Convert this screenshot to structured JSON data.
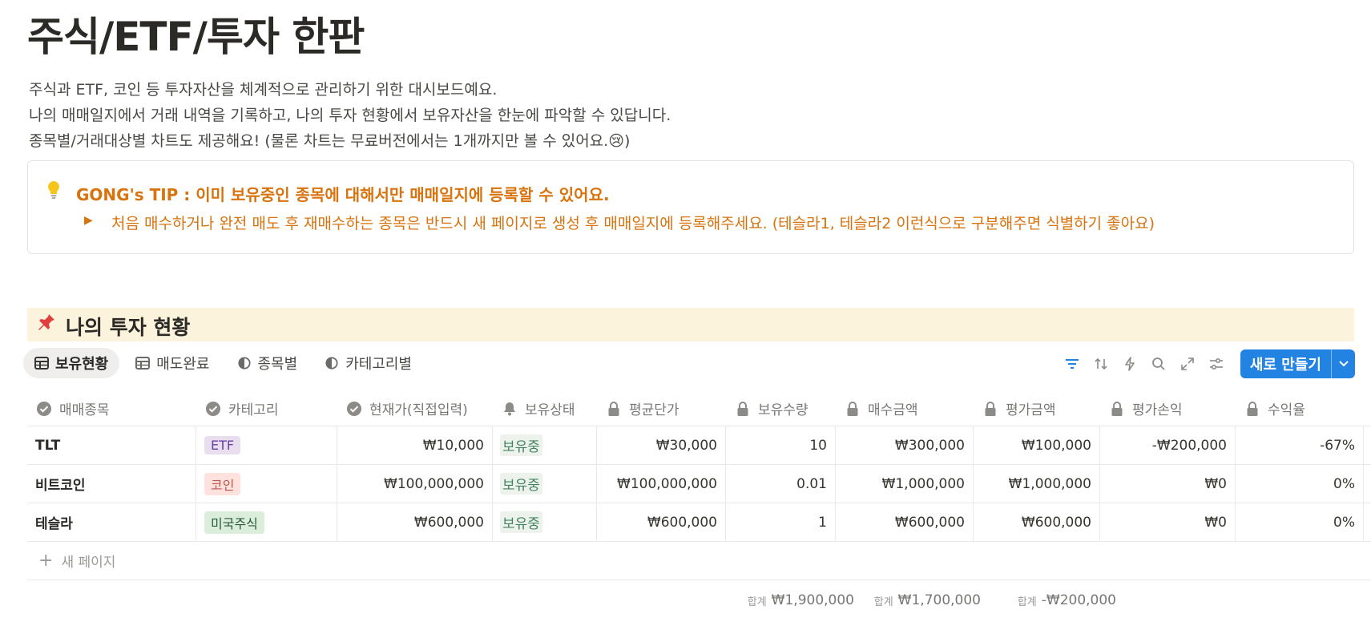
{
  "page": {
    "title": "주식/ETF/투자 한판",
    "description": [
      "주식과 ETF, 코인 등 투자자산을 체계적으로 관리하기 위한 대시보드예요.",
      "나의 매매일지에서 거래 내역을 기록하고, 나의 투자 현황에서 보유자산을 한눈에 파악할 수 있답니다.",
      "종목별/거래대상별 차트도 제공해요! (물론 차트는 무료버전에서는 1개까지만 볼 수 있어요.😢)"
    ]
  },
  "callout": {
    "icon": "lightbulb-icon",
    "title": "GONG's TIP : 이미 보유중인 종목에 대해서만 매매일지에 등록할 수 있어요.",
    "toggle_text": "처음 매수하거나 완전 매도 후 재매수하는 종목은 반드시 새 페이지로 생성 후 매매일지에 등록해주세요. (테슬라1, 테슬라2 이런식으로 구분해주면 식별하기 좋아요)"
  },
  "section": {
    "icon": "pushpin-icon",
    "title": "나의 투자 현황"
  },
  "views": {
    "tabs": [
      {
        "label": "보유현황",
        "icon": "table-icon",
        "active": true
      },
      {
        "label": "매도완료",
        "icon": "table-icon",
        "active": false
      },
      {
        "label": "종목별",
        "icon": "pie-chart-icon",
        "active": false
      },
      {
        "label": "카테고리별",
        "icon": "pie-chart-icon",
        "active": false
      }
    ],
    "new_button_label": "새로 만들기"
  },
  "colors": {
    "accent_blue": "#2383e2",
    "tip_orange": "#d9730d",
    "section_bg": "#fbf3db",
    "status_green": "#448361"
  },
  "table": {
    "columns": [
      {
        "label": "매매종목",
        "icon": "check-circle-icon"
      },
      {
        "label": "카테고리",
        "icon": "check-circle-icon"
      },
      {
        "label": "현재가(직접입력)",
        "icon": "check-circle-icon"
      },
      {
        "label": "보유상태",
        "icon": "bell-icon"
      },
      {
        "label": "평균단가",
        "icon": "lock-icon"
      },
      {
        "label": "보유수량",
        "icon": "lock-icon"
      },
      {
        "label": "매수금액",
        "icon": "lock-icon"
      },
      {
        "label": "평가금액",
        "icon": "lock-icon"
      },
      {
        "label": "평가손익",
        "icon": "lock-icon"
      },
      {
        "label": "수익율",
        "icon": "lock-icon"
      }
    ],
    "rows": [
      {
        "name": "TLT",
        "category": "ETF",
        "category_color": "#e8deee",
        "category_text": "#6940a5",
        "current_price": "₩10,000",
        "status": "보유중",
        "avg_price": "₩30,000",
        "qty": "10",
        "buy_amount": "₩300,000",
        "eval_amount": "₩100,000",
        "pnl": "-₩200,000",
        "return": "-67%"
      },
      {
        "name": "비트코인",
        "category": "코인",
        "category_color": "#ffe2dd",
        "category_text": "#c4554d",
        "current_price": "₩100,000,000",
        "status": "보유중",
        "avg_price": "₩100,000,000",
        "qty": "0.01",
        "buy_amount": "₩1,000,000",
        "eval_amount": "₩1,000,000",
        "pnl": "₩0",
        "return": "0%"
      },
      {
        "name": "테슬라",
        "category": "미국주식",
        "category_color": "#dbeddb",
        "category_text": "#2b593f",
        "current_price": "₩600,000",
        "status": "보유중",
        "avg_price": "₩600,000",
        "qty": "1",
        "buy_amount": "₩600,000",
        "eval_amount": "₩600,000",
        "pnl": "₩0",
        "return": "0%"
      }
    ],
    "new_page_label": "새 페이지",
    "sums": {
      "label": "합계",
      "buy_amount": "₩1,900,000",
      "eval_amount": "₩1,700,000",
      "pnl": "-₩200,000"
    }
  }
}
